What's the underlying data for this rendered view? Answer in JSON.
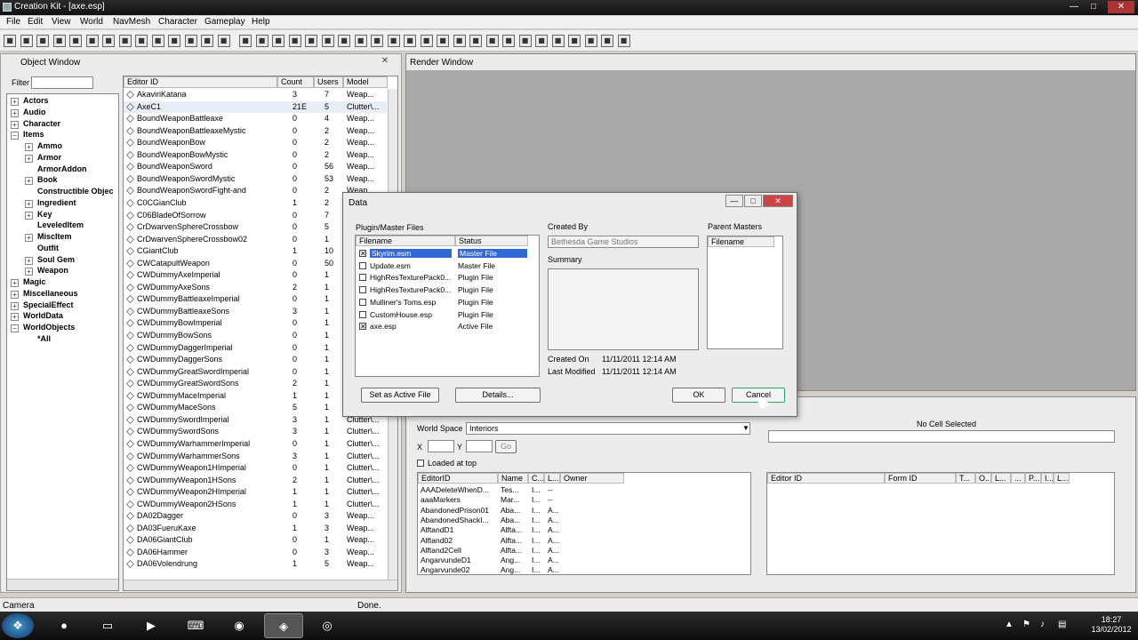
{
  "window": {
    "title": "Creation Kit - [axe.esp]",
    "min": "—",
    "max": "□",
    "close": "✕"
  },
  "menu": [
    "File",
    "Edit",
    "View",
    "World",
    "NavMesh",
    "Character",
    "Gameplay",
    "Help"
  ],
  "toolbar_icons": [
    "open-icon",
    "save-icon",
    "print-icon",
    "undo-icon",
    "redo-icon",
    "tool-icon",
    "tool-icon",
    "tool-icon",
    "tool-icon",
    "tool-icon",
    "tool-icon",
    "tool-icon",
    "tool-icon",
    "tool-icon",
    "tool-icon",
    "tool-icon",
    "tool-icon",
    "tool-icon",
    "tool-icon",
    "tool-icon",
    "tool-icon",
    "tool-icon",
    "tool-icon",
    "tool-icon",
    "tool-icon",
    "tool-icon",
    "tool-icon",
    "tool-icon",
    "tool-icon",
    "tool-icon",
    "tool-icon",
    "tool-icon",
    "tool-icon",
    "tool-icon",
    "tool-icon",
    "tool-icon",
    "tool-icon",
    "tool-icon"
  ],
  "object_window": {
    "title": "Object Window",
    "close": "✕",
    "filter_label": "Filter",
    "tree": [
      {
        "label": "Actors",
        "level": 0,
        "sign": "+"
      },
      {
        "label": "Audio",
        "level": 0,
        "sign": "+"
      },
      {
        "label": "Character",
        "level": 0,
        "sign": "+"
      },
      {
        "label": "Items",
        "level": 0,
        "sign": "−"
      },
      {
        "label": "Ammo",
        "level": 1,
        "sign": "+"
      },
      {
        "label": "Armor",
        "level": 1,
        "sign": "+"
      },
      {
        "label": "ArmorAddon",
        "level": 1,
        "sign": ""
      },
      {
        "label": "Book",
        "level": 1,
        "sign": "+"
      },
      {
        "label": "Constructible Objec",
        "level": 1,
        "sign": ""
      },
      {
        "label": "Ingredient",
        "level": 1,
        "sign": "+"
      },
      {
        "label": "Key",
        "level": 1,
        "sign": "+"
      },
      {
        "label": "LeveledItem",
        "level": 1,
        "sign": ""
      },
      {
        "label": "MiscItem",
        "level": 1,
        "sign": "+"
      },
      {
        "label": "Outfit",
        "level": 1,
        "sign": ""
      },
      {
        "label": "Soul Gem",
        "level": 1,
        "sign": "+"
      },
      {
        "label": "Weapon",
        "level": 1,
        "sign": "+"
      },
      {
        "label": "Magic",
        "level": 0,
        "sign": "+"
      },
      {
        "label": "Miscellaneous",
        "level": 0,
        "sign": "+"
      },
      {
        "label": "SpecialEffect",
        "level": 0,
        "sign": "+"
      },
      {
        "label": "WorldData",
        "level": 0,
        "sign": "+"
      },
      {
        "label": "WorldObjects",
        "level": 0,
        "sign": "−"
      },
      {
        "label": "*All",
        "level": 1,
        "sign": ""
      }
    ],
    "columns": [
      "Editor ID",
      "Count",
      "Users",
      "Model"
    ],
    "rows": [
      [
        "AkaviriKatana",
        "3",
        "7",
        "Weap..."
      ],
      [
        "AxeC1",
        "21E",
        "5",
        "Clutter\\..."
      ],
      [
        "BoundWeaponBattleaxe",
        "0",
        "4",
        "Weap..."
      ],
      [
        "BoundWeaponBattleaxeMystic",
        "0",
        "2",
        "Weap..."
      ],
      [
        "BoundWeaponBow",
        "0",
        "2",
        "Weap..."
      ],
      [
        "BoundWeaponBowMystic",
        "0",
        "2",
        "Weap..."
      ],
      [
        "BoundWeaponSword",
        "0",
        "56",
        "Weap..."
      ],
      [
        "BoundWeaponSwordMystic",
        "0",
        "53",
        "Weap..."
      ],
      [
        "BoundWeaponSwordFight-and",
        "0",
        "2",
        "Weap..."
      ],
      [
        "C0CGianClub",
        "1",
        "2",
        "Weap..."
      ],
      [
        "C06BladeOfSorrow",
        "0",
        "7",
        "Weap..."
      ],
      [
        "CrDwarvenSphereCrossbow",
        "0",
        "5",
        "Weap..."
      ],
      [
        "CrDwarvenSphereCrossbow02",
        "0",
        "1",
        "Weap..."
      ],
      [
        "CGiantClub",
        "1",
        "10",
        "Weap..."
      ],
      [
        "CWCatapultWeapon",
        "0",
        "50",
        "Weap..."
      ],
      [
        "CWDummyAxeImperial",
        "0",
        "1",
        "Weap..."
      ],
      [
        "CWDummyAxeSons",
        "2",
        "1",
        "Weap..."
      ],
      [
        "CWDummyBattleaxeImperial",
        "0",
        "1",
        "Weap..."
      ],
      [
        "CWDummyBattleaxeSons",
        "3",
        "1",
        "Weap..."
      ],
      [
        "CWDummyBowImperial",
        "0",
        "1",
        "Weap..."
      ],
      [
        "CWDummyBowSons",
        "0",
        "1",
        "Weap..."
      ],
      [
        "CWDummyDaggerImperial",
        "0",
        "1",
        "Weap..."
      ],
      [
        "CWDummyDaggerSons",
        "0",
        "1",
        "Weap..."
      ],
      [
        "CWDummyGreatSwordImperial",
        "0",
        "1",
        "Weap..."
      ],
      [
        "CWDummyGreatSwordSons",
        "2",
        "1",
        "Weap..."
      ],
      [
        "CWDummyMaceImperial",
        "1",
        "1",
        "Weap..."
      ],
      [
        "CWDummyMaceSons",
        "5",
        "1",
        "Weap..."
      ],
      [
        "CWDummySwordImperial",
        "3",
        "1",
        "Clutter\\..."
      ],
      [
        "CWDummySwordSons",
        "3",
        "1",
        "Clutter\\..."
      ],
      [
        "CWDummyWarhammerImperial",
        "0",
        "1",
        "Clutter\\..."
      ],
      [
        "CWDummyWarhammerSons",
        "3",
        "1",
        "Clutter\\..."
      ],
      [
        "CWDummyWeapon1HImperial",
        "0",
        "1",
        "Clutter\\..."
      ],
      [
        "CWDummyWeapon1HSons",
        "2",
        "1",
        "Clutter\\..."
      ],
      [
        "CWDummyWeapon2HImperial",
        "1",
        "1",
        "Clutter\\..."
      ],
      [
        "CWDummyWeapon2HSons",
        "1",
        "1",
        "Clutter\\..."
      ],
      [
        "DA02Dagger",
        "0",
        "3",
        "Weap..."
      ],
      [
        "DA03FueruKaxe",
        "1",
        "3",
        "Weap..."
      ],
      [
        "DA06GiantClub",
        "0",
        "1",
        "Weap..."
      ],
      [
        "DA06Hammer",
        "0",
        "3",
        "Weap..."
      ],
      [
        "DA06Volendrung",
        "1",
        "5",
        "Weap..."
      ]
    ]
  },
  "render_window": {
    "title": "Render Window"
  },
  "cell_view": {
    "worldspace_label": "World Space",
    "worldspace_value": "Interiors",
    "x_label": "X",
    "y_label": "Y",
    "go": "Go",
    "loaded_at_top": "Loaded at top",
    "no_cell": "No Cell Selected",
    "left_columns": [
      "EditorID",
      "Name",
      "C...",
      "L...",
      "Owner"
    ],
    "left_rows": [
      [
        "AAADeleteWhenD...",
        "Tes...",
        "I...",
        "--"
      ],
      [
        "aaaMarkers",
        "Mar...",
        "I...",
        "--"
      ],
      [
        "AbandonedPrison01",
        "Aba...",
        "I...",
        "A..."
      ],
      [
        "AbandonedShackI...",
        "Aba...",
        "I...",
        "A..."
      ],
      [
        "AlftandD1",
        "Alfta...",
        "I...",
        "A..."
      ],
      [
        "Alftand02",
        "Alfta...",
        "I...",
        "A..."
      ],
      [
        "Alftand2Cell",
        "Alfta...",
        "I...",
        "A..."
      ],
      [
        "AngarvundeD1",
        "Ang...",
        "I...",
        "A..."
      ],
      [
        "Angarvunde02",
        "Ang...",
        "I...",
        "A..."
      ]
    ],
    "right_columns": [
      "Editor ID",
      "Form ID",
      "T...",
      "O...",
      "L...",
      "...",
      "P...",
      "I...",
      "L..."
    ]
  },
  "dialog": {
    "title": "Data",
    "min": "—",
    "max": "□",
    "close": "✕",
    "plugin_group": "Plugin/Master Files",
    "col_filename": "Filename",
    "col_status": "Status",
    "files": [
      {
        "name": "Skyrim.esm",
        "status": "Master File",
        "checked": "✕",
        "selected": true
      },
      {
        "name": "Update.esm",
        "status": "Master File",
        "checked": "",
        "selected": false
      },
      {
        "name": "HighResTexturePack0...",
        "status": "Plugin File",
        "checked": "",
        "selected": false
      },
      {
        "name": "HighResTexturePack0...",
        "status": "Plugin File",
        "checked": "",
        "selected": false
      },
      {
        "name": "Mulliner's Toms.esp",
        "status": "Plugin File",
        "checked": "",
        "selected": false
      },
      {
        "name": "CustomHouse.esp",
        "status": "Plugin File",
        "checked": "",
        "selected": false
      },
      {
        "name": "axe.esp",
        "status": "Active File",
        "checked": "✕",
        "selected": false
      }
    ],
    "created_by_label": "Created By",
    "created_by_value": "Bethesda Game Studios",
    "summary_label": "Summary",
    "created_on_label": "Created On",
    "created_on_value": "11/11/2011 12:14 AM",
    "last_modified_label": "Last Modified",
    "last_modified_value": "11/11/2011 12:14 AM",
    "parent_masters_label": "Parent Masters",
    "parent_col": "Filename",
    "set_active": "Set as Active File",
    "details": "Details...",
    "ok": "OK",
    "cancel": "Cancel"
  },
  "status": {
    "left": "Camera",
    "mid": "Done."
  },
  "taskbar": {
    "clock_time": "18:27",
    "clock_date": "13/02/2012"
  }
}
